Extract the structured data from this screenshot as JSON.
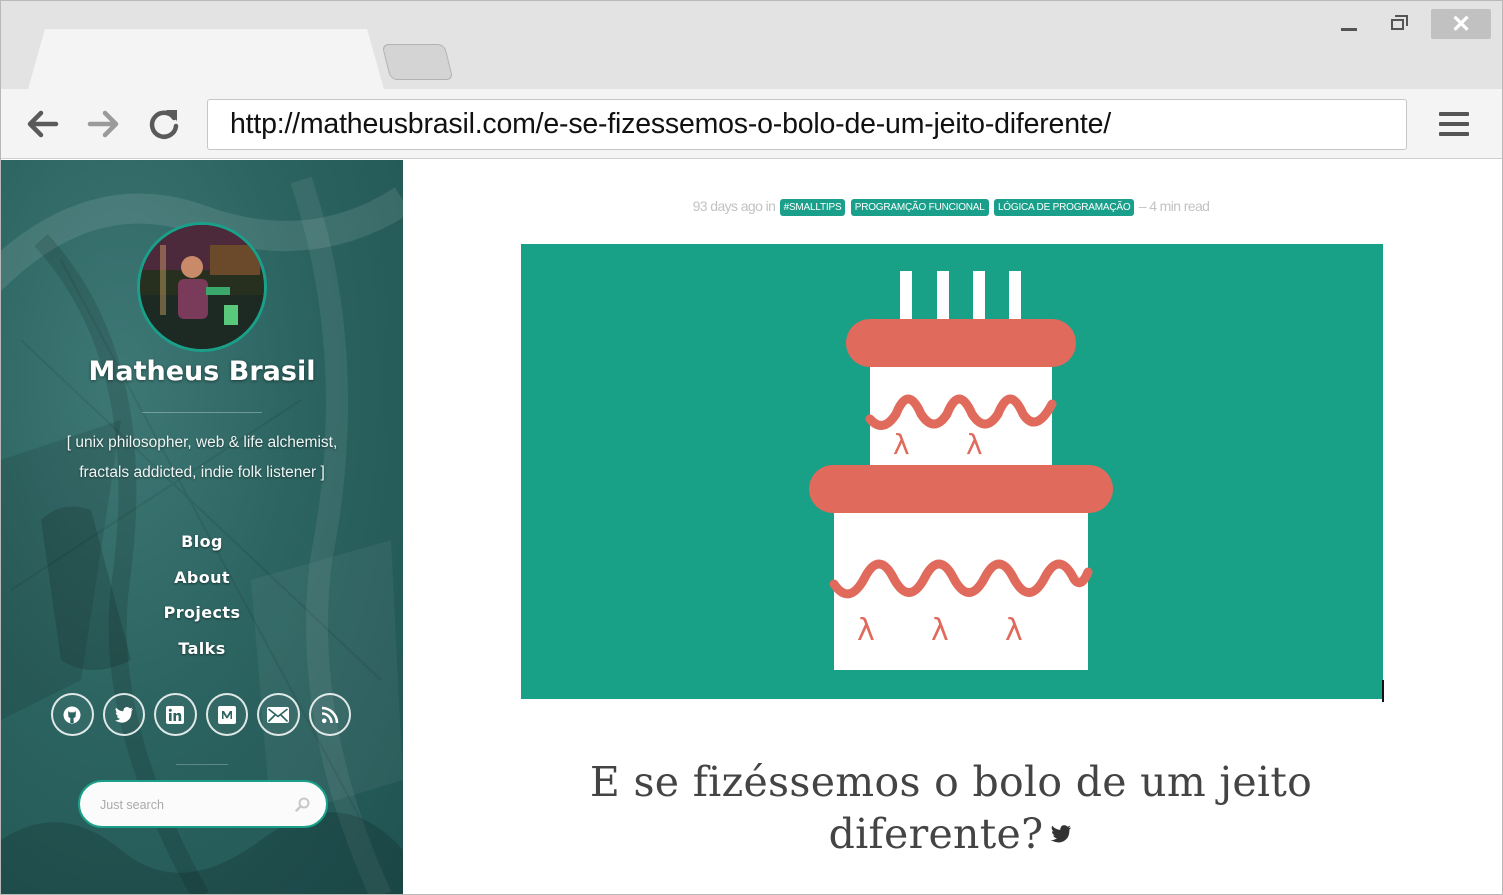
{
  "browser": {
    "url": "http://matheusbrasil.com/e-se-fizessemos-o-bolo-de-um-jeito-diferente/",
    "close_glyph": "✕",
    "icons": [
      "back-arrow-icon",
      "forward-arrow-icon",
      "reload-icon",
      "hamburger-menu-icon",
      "minimize-icon",
      "maximize-icon",
      "close-icon"
    ]
  },
  "sidebar": {
    "author_name": "Matheus Brasil",
    "bio_line1": "[ unix philosopher, web & life alchemist,",
    "bio_line2": "fractals addicted, indie folk listener ]",
    "nav": [
      {
        "label": "Blog"
      },
      {
        "label": "About"
      },
      {
        "label": "Projects"
      },
      {
        "label": "Talks"
      }
    ],
    "social_icons": [
      "github-icon",
      "twitter-icon",
      "linkedin-icon",
      "medium-icon",
      "email-icon",
      "rss-icon"
    ],
    "search_placeholder": "Just search"
  },
  "post": {
    "meta_prefix": "93 days ago in",
    "tags": [
      "#SMALLTIPS",
      "PROGRAMÇÃO FUNCIONAL",
      "LÓGICA DE PROGRAMAÇÃO"
    ],
    "meta_suffix": "– 4 min read",
    "title_line1": "E se fizéssemos o bolo de um jeito",
    "title_line2": "diferente?",
    "hero_symbol": "λ"
  },
  "colors": {
    "accent": "#1aa08a",
    "hero_bg": "#19a187",
    "cake_red": "#e06a5b",
    "sidebar_bg": "#2c6461"
  }
}
